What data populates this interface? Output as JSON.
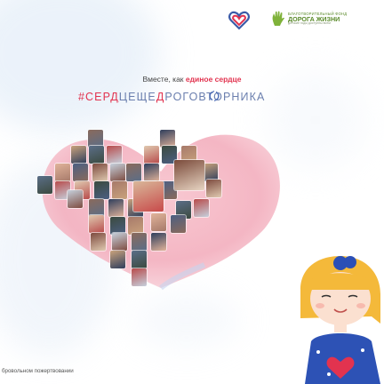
{
  "tagline": {
    "prefix": "Вместе, как",
    "accent": "единое сердце"
  },
  "hashtag": {
    "p1": "#СЕР",
    "p2": "Д",
    "p3": "ЦЕЩЕ",
    "p4": "Д",
    "p5": "РОГОВТОРНИКА"
  },
  "partner": {
    "line1": "БЛАГОТВОРИТЕЛЬНЫЙ ФОНД",
    "line2": "ДОРОГА ЖИЗНИ",
    "line3": "детские годы доступны всем"
  },
  "footer": {
    "text": "бровольном пожертвовании"
  },
  "icons": {
    "logo": "heart-logo-icon",
    "partner": "hand-logo-icon",
    "share": "share-icon"
  },
  "colors": {
    "accent": "#e2334f",
    "hashtag": "#6b7fae",
    "heart": "#f4b7c2"
  }
}
